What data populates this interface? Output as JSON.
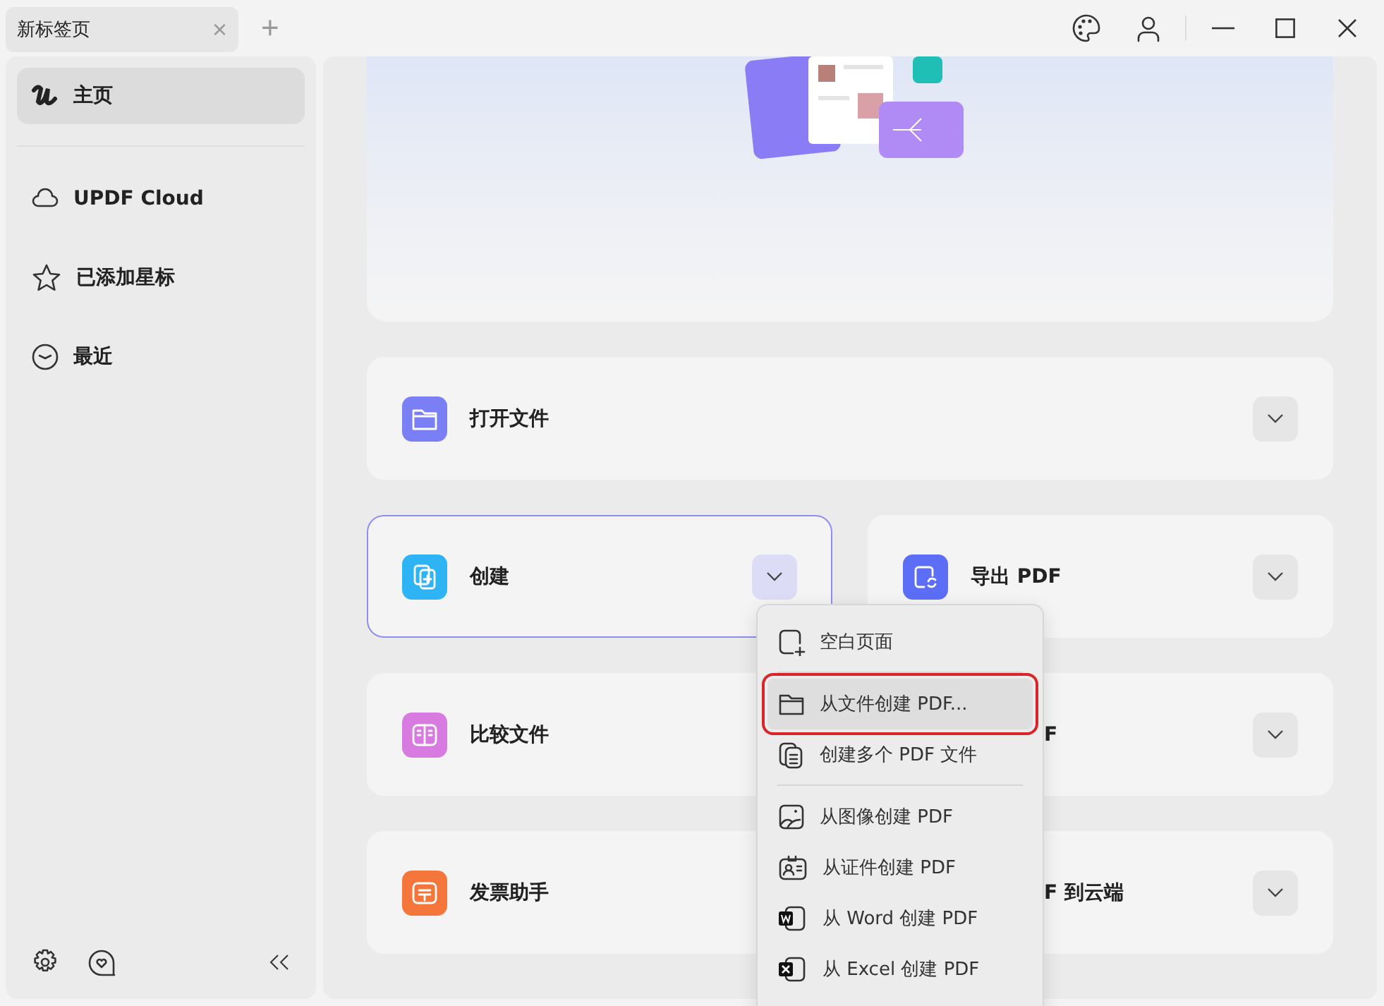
{
  "tab": {
    "title": "新标签页",
    "close": "×",
    "new_tab": "+"
  },
  "sidebar": {
    "items": [
      {
        "label": "主页",
        "selected": true
      },
      {
        "label": "UPDF Cloud",
        "selected": false
      },
      {
        "label": "已添加星标",
        "selected": false
      },
      {
        "label": "最近",
        "selected": false
      }
    ]
  },
  "cards": [
    [
      {
        "label": "打开文件",
        "color": "#7b7ff5",
        "expanded": false,
        "kind": "full"
      }
    ],
    [
      {
        "label": "创建",
        "color": "#2eb3f5",
        "expanded": true,
        "kind": "full"
      },
      {
        "label": "导出 PDF",
        "color": "#5c6ef5",
        "expanded": false,
        "kind": "full"
      }
    ],
    [
      {
        "label": "比较文件",
        "color": "#d77be0",
        "expanded": false,
        "kind": "full"
      },
      {
        "label": "F",
        "expanded": false,
        "kind": "covered"
      }
    ],
    [
      {
        "label": "发票助手",
        "color": "#f5763a",
        "expanded": false,
        "kind": "full"
      },
      {
        "label": "F 到云端",
        "expanded": false,
        "kind": "covered"
      }
    ]
  ],
  "menu": {
    "items": [
      {
        "kind": "item",
        "label": "空白页面",
        "selected": false,
        "highlighted": false
      },
      {
        "kind": "divider"
      },
      {
        "kind": "item",
        "label": "从文件创建 PDF...",
        "selected": true,
        "highlighted": true
      },
      {
        "kind": "item",
        "label": "创建多个 PDF 文件",
        "selected": false,
        "highlighted": false
      },
      {
        "kind": "divider"
      },
      {
        "kind": "item",
        "label": "从图像创建 PDF",
        "selected": false,
        "highlighted": false
      },
      {
        "kind": "item",
        "label": "从证件创建 PDF",
        "selected": false,
        "highlighted": false
      },
      {
        "kind": "item",
        "label": "从 Word 创建 PDF",
        "selected": false,
        "highlighted": false
      },
      {
        "kind": "item",
        "label": "从 Excel 创建 PDF",
        "selected": false,
        "highlighted": false
      }
    ]
  }
}
